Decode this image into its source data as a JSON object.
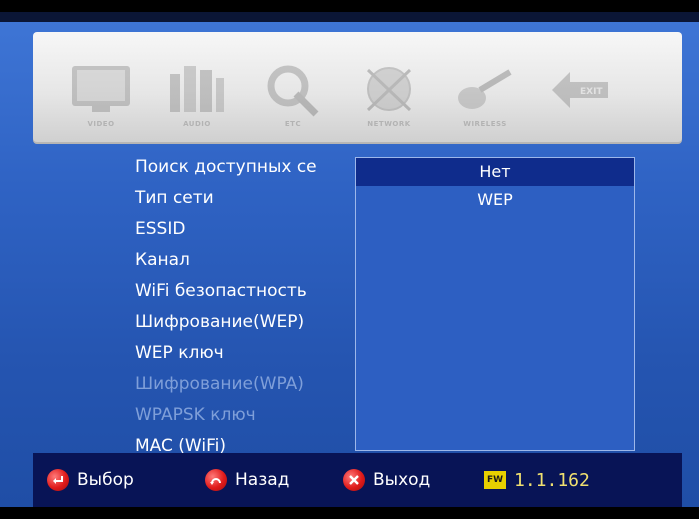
{
  "toolbar": {
    "items": [
      {
        "label": "VIDEO",
        "icon": "tv-icon"
      },
      {
        "label": "AUDIO",
        "icon": "speaker-icon"
      },
      {
        "label": "ETC",
        "icon": "tools-icon"
      },
      {
        "label": "NETWORK",
        "icon": "globe-icon"
      },
      {
        "label": "WIRELESS",
        "icon": "wireless-icon"
      },
      {
        "label": "EXIT",
        "icon": "exit-icon"
      }
    ]
  },
  "menu": {
    "items": [
      {
        "label": "Поиск доступных се",
        "enabled": true
      },
      {
        "label": "Тип сети",
        "enabled": true
      },
      {
        "label": "ESSID",
        "enabled": true
      },
      {
        "label": "Канал",
        "enabled": true
      },
      {
        "label": "WiFi безопастность",
        "enabled": true
      },
      {
        "label": "Шифрование(WEP)",
        "enabled": true
      },
      {
        "label": "WEP ключ",
        "enabled": true
      },
      {
        "label": "Шифрование(WPA)",
        "enabled": false
      },
      {
        "label": "WPAPSK ключ",
        "enabled": false
      },
      {
        "label": "MAC (WiFi)",
        "enabled": true
      }
    ]
  },
  "dropdown": {
    "options": [
      "Нет",
      "WEP"
    ],
    "selected": "Нет"
  },
  "bottom": {
    "select_label": "Выбор",
    "back_label": "Назад",
    "exit_label": "Выход",
    "fw_badge": "FW",
    "fw_version": "1.1.162"
  },
  "colors": {
    "background": "#2f63c4",
    "selected_option": "#0f2c8c",
    "bottom_bar": "#081456",
    "hint_icon": "#e01b1b",
    "fw_badge": "#e8d000"
  }
}
